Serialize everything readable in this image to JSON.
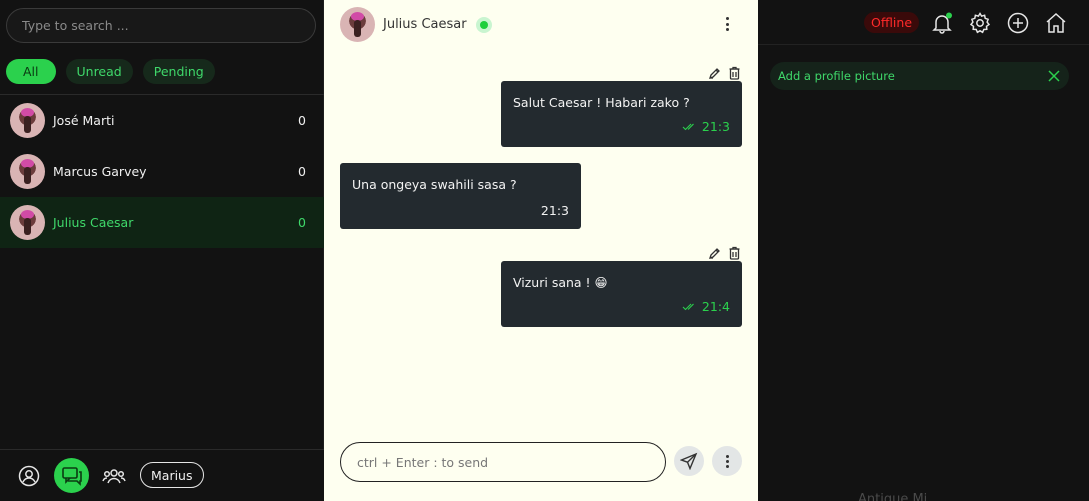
{
  "sidebar": {
    "search_placeholder": "Type to search ...",
    "filters": [
      "All",
      "Unread",
      "Pending"
    ],
    "contacts": [
      {
        "name": "José Marti",
        "count": "0"
      },
      {
        "name": "Marcus Garvey",
        "count": "0"
      },
      {
        "name": "Julius Caesar",
        "count": "0"
      }
    ],
    "current_user": "Marius"
  },
  "chat": {
    "contact_name": "Julius Caesar",
    "messages": [
      {
        "direction": "out",
        "text": "Salut Caesar ! Habari zako ?",
        "time": "21:3"
      },
      {
        "direction": "in",
        "text": "Una ongeya swahili sasa ?",
        "time": "21:3"
      },
      {
        "direction": "out",
        "text": "Vizuri sana ! 😁",
        "time": "21:4"
      }
    ],
    "composer_placeholder": "ctrl + Enter : to send"
  },
  "topbar": {
    "status": "Offline"
  },
  "notice": {
    "text": "Add a profile picture"
  },
  "right_footer_partial": "Antique Mi...",
  "colors": {
    "accent": "#2bd14d",
    "chat_bg": "#fefff0",
    "bubble": "#232a2f",
    "offline": "#ff2a2a",
    "dark_bg": "#121212"
  }
}
